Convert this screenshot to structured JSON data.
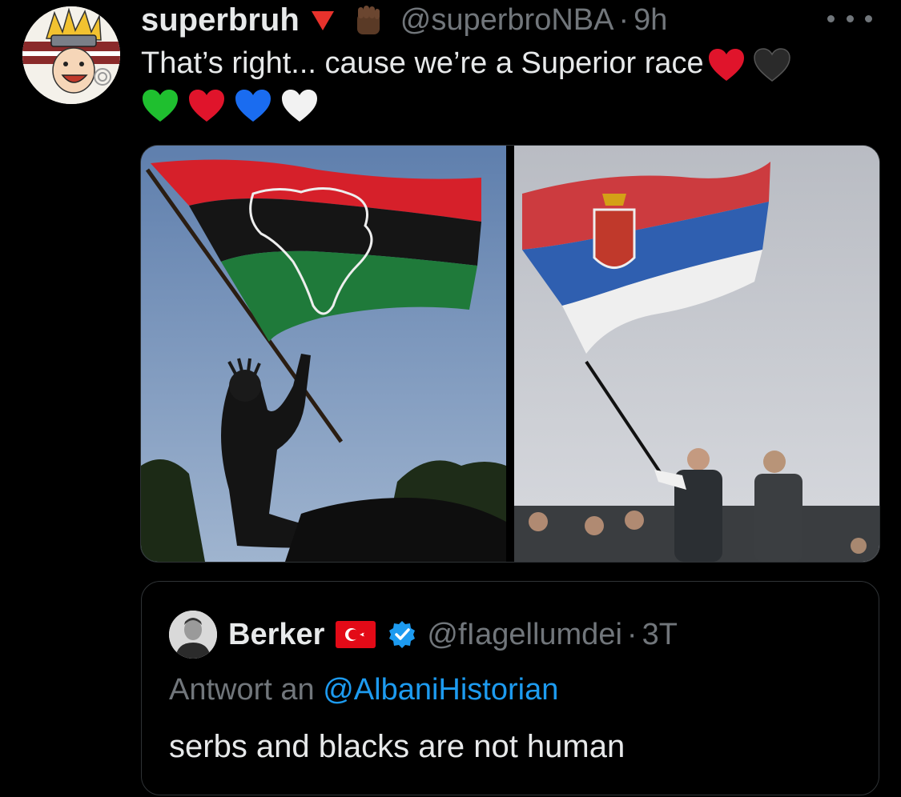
{
  "tweet": {
    "author": {
      "display_name": "superbruh",
      "handle": "@superbroNBA",
      "time": "9h",
      "badges": [
        "red-triangle-icon",
        "raised-fist-icon"
      ]
    },
    "more_icon": "more-icon",
    "text": "That’s right... cause we’re a Superior race",
    "text_hearts": [
      "red-heart-icon",
      "black-heart-icon"
    ],
    "line2_hearts": [
      "green-heart-icon",
      "red-heart-icon",
      "blue-heart-icon",
      "white-heart-icon"
    ],
    "media": [
      {
        "subject": "pan-african-flag-photo"
      },
      {
        "subject": "serbian-flag-photo"
      }
    ],
    "separator": "·"
  },
  "quote": {
    "author": {
      "display_name": "Berker",
      "handle": "@fIagellumdei",
      "time": "3T",
      "flag": "turkey-flag-icon",
      "verified": "verified-badge-icon"
    },
    "reply_prefix": "Antwort an",
    "reply_mention": "@AlbaniHistorian",
    "text": "serbs and blacks are not human"
  },
  "colors": {
    "background": "#000000",
    "primary_text": "#e7e9ea",
    "secondary_text": "#71767b",
    "link": "#1d9bf0",
    "border": "#2f3336"
  }
}
